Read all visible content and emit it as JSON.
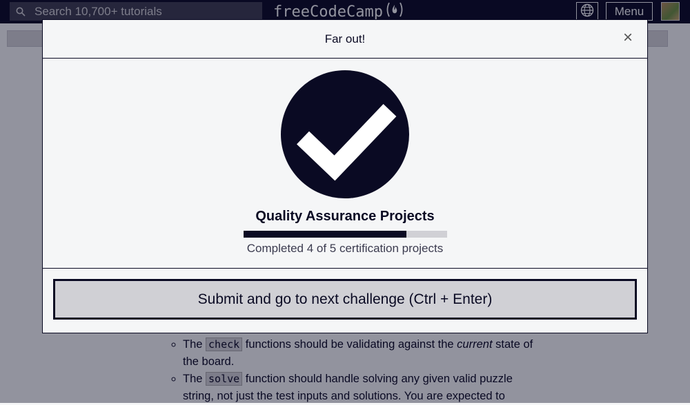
{
  "navbar": {
    "search_placeholder": "Search 10,700+ tutorials",
    "brand": "freeCodeCamp",
    "menu_label": "Menu"
  },
  "background": {
    "items": [
      {
        "pre": "The",
        "code": "check",
        "mid": "functions should be validating against the",
        "em": "current",
        "post": "state of the board."
      },
      {
        "pre": "The",
        "code": "solve",
        "mid": "function should handle solving any given valid puzzle string, not just the test inputs and solutions. You are expected to",
        "em": "",
        "post": ""
      }
    ]
  },
  "modal": {
    "title": "Far out!",
    "close_label": "×",
    "cert_title": "Quality Assurance Projects",
    "progress_text": "Completed 4 of 5 certification projects",
    "progress": {
      "completed": 4,
      "total": 5
    },
    "submit_label": "Submit and go to next challenge (Ctrl + Enter)"
  },
  "colors": {
    "primary": "#0a0a23",
    "background": "#f5f6f7",
    "button": "#d0d0d5"
  }
}
